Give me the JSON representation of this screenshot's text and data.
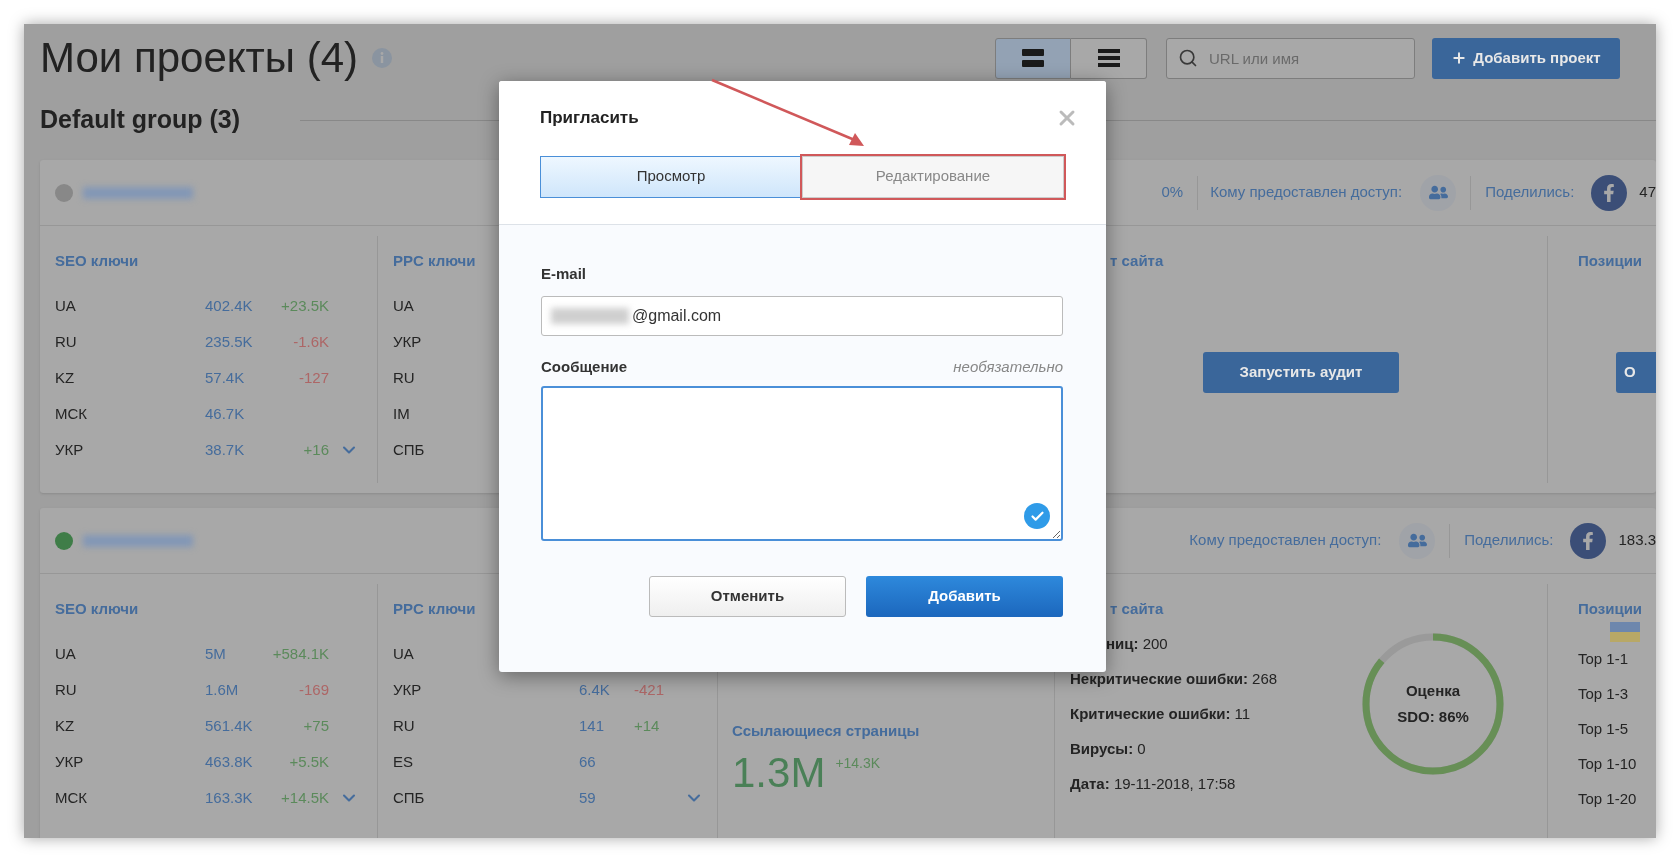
{
  "page": {
    "title": "Мои проекты (4)",
    "group_title": "Default group (3)",
    "search": {
      "placeholder": "URL или имя"
    },
    "view_toggle": [
      {
        "kind": "cards",
        "selected": true
      },
      {
        "kind": "list",
        "selected": false
      }
    ],
    "add_button": "Добавить проект"
  },
  "projects": [
    {
      "color": "#888888",
      "header_fragment": "0%",
      "access_label": "Кому предоставлен доступ:",
      "shared_label": "Поделились:",
      "shared_count": "47",
      "seo": {
        "title": "SEO ключи",
        "rows": [
          {
            "region": "UA",
            "value": "402.4K",
            "change": "+23.5K",
            "color": "#5b8a5b"
          },
          {
            "region": "RU",
            "value": "235.5K",
            "change": "-1.6K",
            "color": "#ad6666"
          },
          {
            "region": "KZ",
            "value": "57.4K",
            "change": "-127",
            "color": "#ad6666"
          },
          {
            "region": "МСК",
            "value": "46.7K"
          },
          {
            "region": "УКР",
            "value": "38.7K",
            "change": "+16",
            "color": "#5b8a5b"
          }
        ]
      },
      "ppc": {
        "title": "PPC ключи",
        "rows": [
          {
            "region": "UA"
          },
          {
            "region": "УКР"
          },
          {
            "region": "RU"
          },
          {
            "region": "IM"
          },
          {
            "region": "СПБ"
          }
        ]
      },
      "audit": {
        "title": "т сайта",
        "button": "Запустить аудит"
      },
      "positions": {
        "title": "Позиции",
        "button": "О"
      }
    },
    {
      "color": "#3f7d48",
      "access_label": "Кому предоставлен доступ:",
      "shared_label": "Поделились:",
      "shared_count": "183.3",
      "seo": {
        "title": "SEO ключи",
        "rows": [
          {
            "region": "UA",
            "value": "5M",
            "change": "+584.1K",
            "color": "#5b8a5b"
          },
          {
            "region": "RU",
            "value": "1.6M",
            "change": "-169",
            "color": "#ad6666"
          },
          {
            "region": "KZ",
            "value": "561.4K",
            "change": "+75",
            "color": "#5b8a5b"
          },
          {
            "region": "УКР",
            "value": "463.8K",
            "change": "+5.5K",
            "color": "#5b8a5b"
          },
          {
            "region": "МСК",
            "value": "163.3K",
            "change": "+14.5K",
            "color": "#5b8a5b"
          }
        ]
      },
      "ppc": {
        "title": "PPC ключи",
        "rows": [
          {
            "region": "UA"
          },
          {
            "region": "УКР",
            "value": "6.4K",
            "change": "-421",
            "color": "#ad6666"
          },
          {
            "region": "RU",
            "value": "141",
            "change": "+14",
            "color": "#5b8a5b"
          },
          {
            "region": "ES",
            "value": "66"
          },
          {
            "region": "СПБ",
            "value": "59"
          }
        ]
      },
      "backlinks": {
        "title": "Ссылающиеся страницы",
        "value": "1.3M",
        "change": "+14.3K"
      },
      "audit": {
        "title": "т сайта",
        "stats": [
          "**ниц:** 200",
          "**Некритические ошибки:** 268",
          "**Критические ошибки:** 11",
          "**Вирусы:** 0",
          "**Дата:** 19-11-2018, 17:58"
        ],
        "score": {
          "label": "Оценка",
          "value": "SDO: 86%",
          "level": 0.86
        }
      },
      "positions": {
        "title": "Позиции",
        "rows": [
          "Top 1-1",
          "Top 1-3",
          "Top 1-5",
          "Top 1-10",
          "Top 1-20"
        ]
      }
    }
  ],
  "dialog": {
    "title": "Пригласить",
    "tabs": [
      {
        "label": "Просмотр",
        "selected": true,
        "highlighted": false
      },
      {
        "label": "Редактирование",
        "selected": false,
        "highlighted": true
      }
    ],
    "email": {
      "label": "E-mail",
      "value": "@gmail.com"
    },
    "message": {
      "label": "Сообщение",
      "hint": "необязательно"
    },
    "buttons": [
      {
        "label": "Отменить",
        "kind": "secondary"
      },
      {
        "label": "Добавить",
        "kind": "primary"
      }
    ]
  }
}
